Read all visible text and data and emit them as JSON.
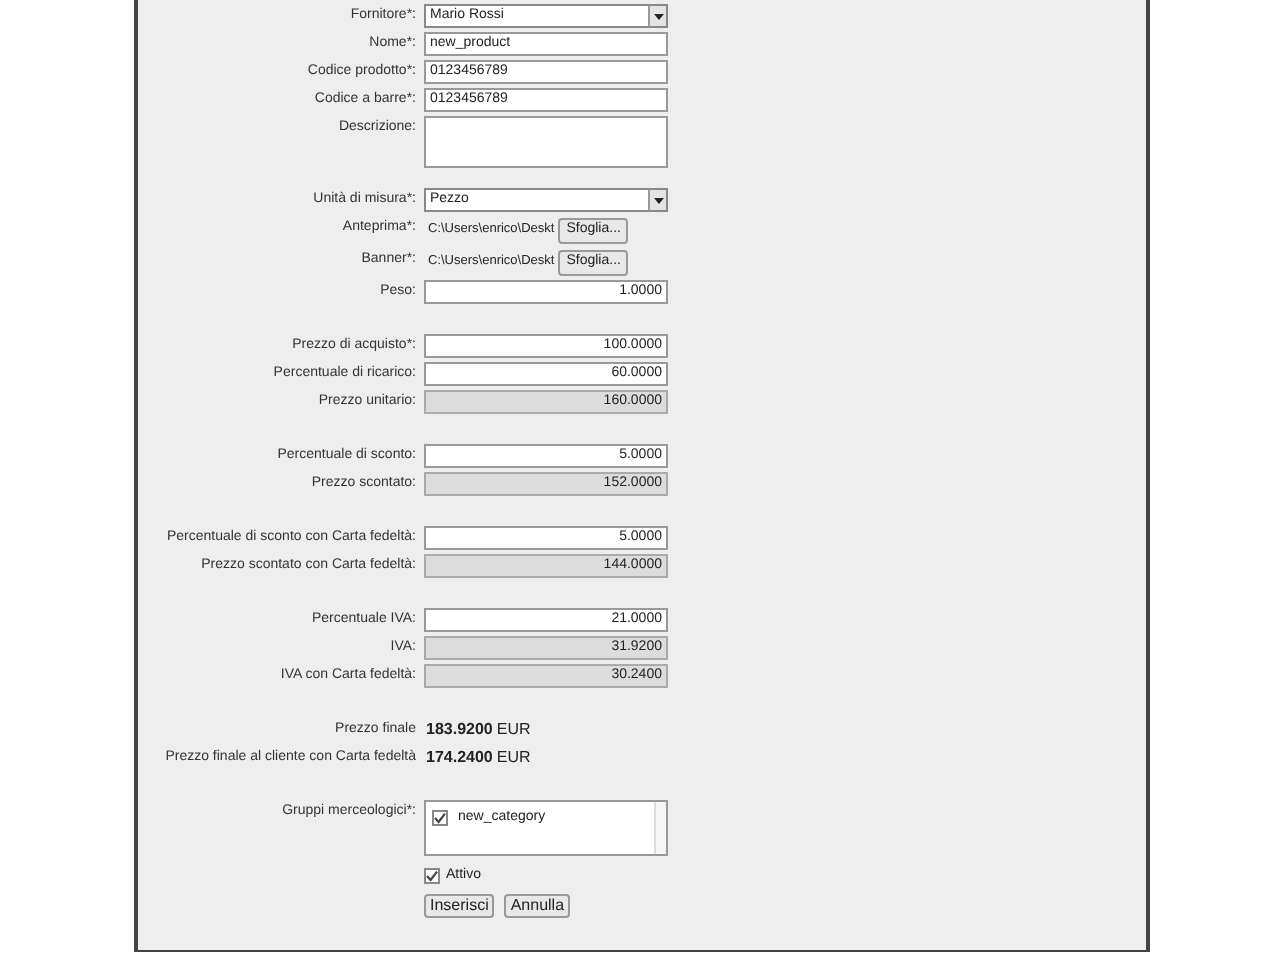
{
  "sections": [
    {
      "rows": [
        {
          "kind": "select",
          "label": "Fornitore*:",
          "value": "Mario Rossi"
        },
        {
          "kind": "text",
          "label": "Nome*:",
          "value": "new_product"
        },
        {
          "kind": "text",
          "label": "Codice prodotto*:",
          "value": "0123456789"
        },
        {
          "kind": "text",
          "label": "Codice a barre*:",
          "value": "0123456789"
        },
        {
          "kind": "textarea",
          "label": "Descrizione:"
        },
        {
          "kind": "select",
          "label": "Unità di misura*:",
          "value": "Pezzo"
        },
        {
          "kind": "file",
          "label": "Anteprima*:",
          "value": "C:\\Users\\enrico\\Deskt",
          "button": "Sfoglia..."
        },
        {
          "kind": "file",
          "label": "Banner*:",
          "value": "C:\\Users\\enrico\\Deskt",
          "button": "Sfoglia..."
        },
        {
          "kind": "number",
          "label": "Peso:",
          "value": "1.0000"
        }
      ]
    },
    {
      "rows": [
        {
          "kind": "number",
          "label": "Prezzo di acquisto*:",
          "value": "100.0000"
        },
        {
          "kind": "number",
          "label": "Percentuale di ricarico:",
          "value": "60.0000"
        },
        {
          "kind": "readonly",
          "label": "Prezzo unitario:",
          "value": "160.0000"
        }
      ]
    },
    {
      "rows": [
        {
          "kind": "number",
          "label": "Percentuale di sconto:",
          "value": "5.0000"
        },
        {
          "kind": "readonly",
          "label": "Prezzo scontato:",
          "value": "152.0000"
        }
      ]
    },
    {
      "rows": [
        {
          "kind": "number",
          "label": "Percentuale di sconto con Carta fedeltà:",
          "value": "5.0000"
        },
        {
          "kind": "readonly",
          "label": "Prezzo scontato con Carta fedeltà:",
          "value": "144.0000"
        }
      ]
    },
    {
      "rows": [
        {
          "kind": "number",
          "label": "Percentuale IVA:",
          "value": "21.0000"
        },
        {
          "kind": "readonly",
          "label": "IVA:",
          "value": "31.9200"
        },
        {
          "kind": "readonly",
          "label": "IVA con Carta fedeltà:",
          "value": "30.2400"
        }
      ]
    },
    {
      "rows": [
        {
          "kind": "total",
          "label": "Prezzo finale",
          "value": "183.9200",
          "unit": "EUR"
        },
        {
          "kind": "total",
          "label": "Prezzo finale al cliente con Carta fedeltà",
          "value": "174.2400",
          "unit": "EUR"
        }
      ]
    },
    {
      "rows": [
        {
          "kind": "listbox",
          "label": "Gruppi merceologici*:",
          "options": [
            {
              "label": "new_category",
              "checked": true
            }
          ]
        },
        {
          "kind": "checkbox",
          "label": "Attivo",
          "checked": true
        },
        {
          "kind": "buttons",
          "buttons": [
            "Inserisci",
            "Annulla"
          ]
        }
      ]
    }
  ]
}
